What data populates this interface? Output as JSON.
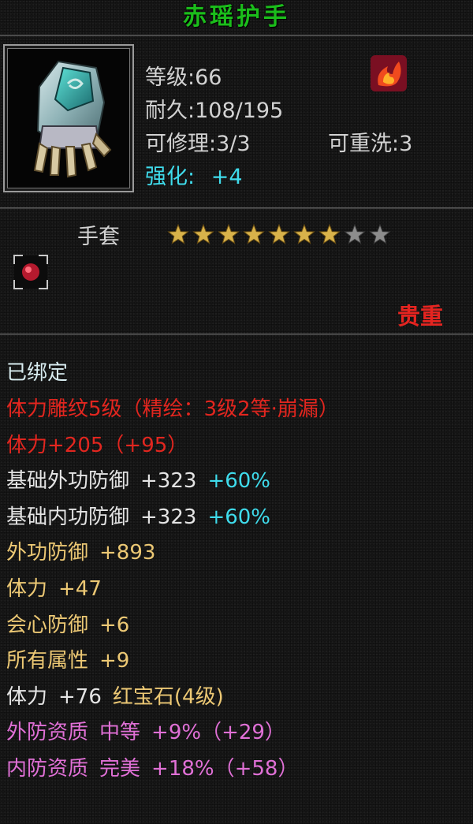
{
  "item": {
    "name": "赤瑶护手",
    "icon": "gauntlet-icon",
    "badge_icon": "flame-icon",
    "level": "等级:66",
    "durability": "耐久:108/195",
    "repair": "可修理:3/3",
    "rewash": "可重洗:3",
    "enhance_label": "强化:",
    "enhance_value": "+4",
    "slot": "手套",
    "stars": {
      "filled": 7,
      "total": 9
    },
    "gem_slot_icon": "ruby-gem-icon",
    "rarity": "贵重",
    "bound": "已绑定"
  },
  "attributes": [
    {
      "parts": [
        {
          "text": "体力雕纹5级（精绘：3级2等·崩漏）",
          "color": "red"
        }
      ]
    },
    {
      "parts": [
        {
          "text": "体力+205（+95）",
          "color": "red"
        }
      ]
    },
    {
      "parts": [
        {
          "text": "基础外功防御",
          "color": "white"
        },
        {
          "text": "+323",
          "color": "white"
        },
        {
          "text": "+60%",
          "color": "cyan"
        }
      ]
    },
    {
      "parts": [
        {
          "text": "基础内功防御",
          "color": "white"
        },
        {
          "text": "+323",
          "color": "white"
        },
        {
          "text": "+60%",
          "color": "cyan"
        }
      ]
    },
    {
      "parts": [
        {
          "text": "外功防御",
          "color": "gold"
        },
        {
          "text": "+893",
          "color": "gold"
        }
      ]
    },
    {
      "parts": [
        {
          "text": "体力",
          "color": "gold"
        },
        {
          "text": "+47",
          "color": "gold"
        }
      ]
    },
    {
      "parts": [
        {
          "text": "会心防御",
          "color": "gold"
        },
        {
          "text": "+6",
          "color": "gold"
        }
      ]
    },
    {
      "parts": [
        {
          "text": "所有属性",
          "color": "gold"
        },
        {
          "text": "+9",
          "color": "gold"
        }
      ]
    },
    {
      "parts": [
        {
          "text": "体力",
          "color": "white"
        },
        {
          "text": "+76",
          "color": "white"
        },
        {
          "text": "红宝石(4级)",
          "color": "gold"
        }
      ]
    },
    {
      "parts": [
        {
          "text": "外防资质",
          "color": "pink"
        },
        {
          "text": "中等",
          "color": "pink"
        },
        {
          "text": "+9%（+29）",
          "color": "pink"
        }
      ]
    },
    {
      "parts": [
        {
          "text": "内防资质",
          "color": "pink"
        },
        {
          "text": "完美",
          "color": "pink"
        },
        {
          "text": "+18%（+58）",
          "color": "pink"
        }
      ]
    }
  ],
  "colors": {
    "title_green": "#1bbd1b",
    "enhance_cyan": "#3fdcec",
    "rarity_red": "#e52420",
    "attr_red": "#e2261f",
    "attr_gold": "#ecc874",
    "attr_pink": "#e070d6"
  }
}
